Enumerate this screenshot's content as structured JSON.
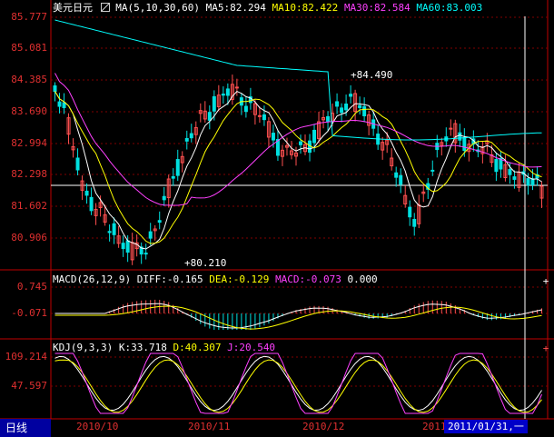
{
  "main": {
    "title": "美元日元",
    "ma_label": "MA(5,10,30,60)",
    "ma5": "MA5:82.294",
    "ma10": "MA10:82.422",
    "ma30": "MA30:82.584",
    "ma60": "MA60:83.003",
    "y_ticks": [
      "85.777",
      "85.081",
      "84.385",
      "83.690",
      "82.994",
      "82.298",
      "81.602",
      "80.906"
    ],
    "high_mark": "84.490",
    "low_mark": "80.210"
  },
  "macd": {
    "label": "MACD(26,12,9)",
    "diff": "DIFF:-0.165",
    "dea": "DEA:-0.129",
    "macd": "MACD:-0.073",
    "extra": "0.000",
    "y_ticks": [
      "0.745",
      "-0.071"
    ]
  },
  "kdj": {
    "label": "KDJ(9,3,3)",
    "k": "K:33.718",
    "d": "D:40.307",
    "j": "J:20.540",
    "y_ticks": [
      "109.214",
      "47.597"
    ]
  },
  "xaxis": {
    "labels": [
      "2010/10",
      "2010/11",
      "2010/12",
      "2011"
    ],
    "cursor_date": "2011/01/31,一"
  },
  "tab": {
    "label": "日线"
  },
  "colors": {
    "up": "#ff5050",
    "down": "#00e0e0",
    "ma5": "#ffffff",
    "ma10": "#ffff00",
    "ma30": "#ff40ff",
    "ma60": "#00ffff",
    "grid": "#800000",
    "axis": "#c00000"
  }
}
